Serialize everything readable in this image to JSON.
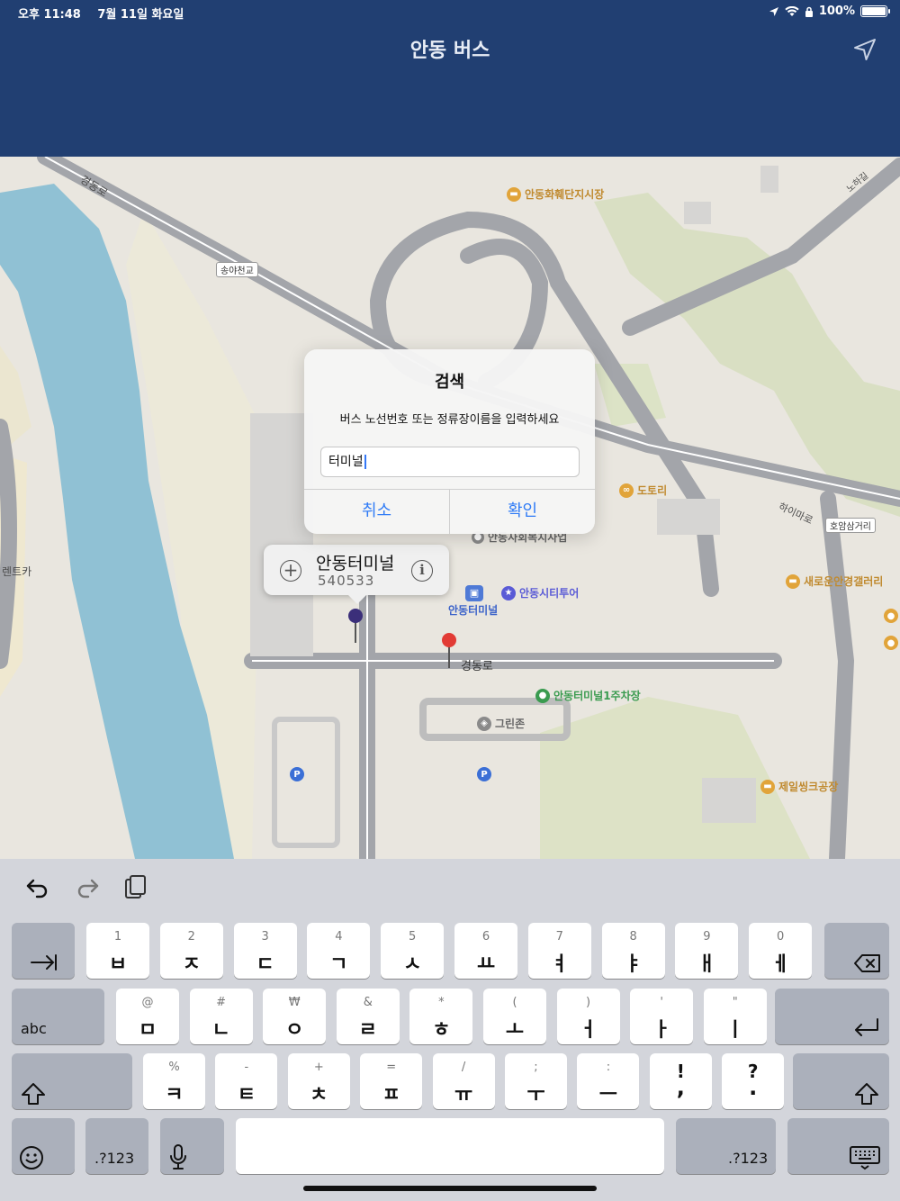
{
  "status": {
    "time": "오후 11:48",
    "date": "7월 11일 화요일",
    "battery": "100%"
  },
  "nav": {
    "title": "안동 버스"
  },
  "map": {
    "road_labels": {
      "gyeongdong_nw": "경동로",
      "songya_bridge": "송야천교",
      "nohagil": "노하길",
      "haimaro": "하이마로",
      "hoamsamgeori": "호암삼거리",
      "gyeongdong_main": "경동로",
      "rentcar": "렌트카"
    },
    "pois": {
      "hwahoe_market": "안동화훼단지시장",
      "dotori": "도토리",
      "welfare_center": "안동사회복지사업",
      "city_tour": "안동시티투어",
      "terminal_bus": "안동터미널",
      "serowoon": "새로운안경갤러리",
      "parking1": "안동터미널1주차장",
      "greenzone": "그린존",
      "jeil_sink": "제일씽크공장"
    },
    "callout": {
      "title": "안동터미널",
      "subtitle": "540533"
    }
  },
  "dialog": {
    "title": "검색",
    "message": "버스 노선번호 또는 정류장이름을 입력하세요",
    "input_value": "터미널",
    "cancel_label": "취소",
    "confirm_label": "확인"
  },
  "keyboard": {
    "row1": [
      {
        "hint": "1",
        "main": "ㅂ"
      },
      {
        "hint": "2",
        "main": "ㅈ"
      },
      {
        "hint": "3",
        "main": "ㄷ"
      },
      {
        "hint": "4",
        "main": "ㄱ"
      },
      {
        "hint": "5",
        "main": "ㅅ"
      },
      {
        "hint": "6",
        "main": "ㅛ"
      },
      {
        "hint": "7",
        "main": "ㅕ"
      },
      {
        "hint": "8",
        "main": "ㅑ"
      },
      {
        "hint": "9",
        "main": "ㅐ"
      },
      {
        "hint": "0",
        "main": "ㅔ"
      }
    ],
    "row2": [
      {
        "hint": "@",
        "main": "ㅁ"
      },
      {
        "hint": "#",
        "main": "ㄴ"
      },
      {
        "hint": "₩",
        "main": "ㅇ"
      },
      {
        "hint": "&",
        "main": "ㄹ"
      },
      {
        "hint": "*",
        "main": "ㅎ"
      },
      {
        "hint": "(",
        "main": "ㅗ"
      },
      {
        "hint": ")",
        "main": "ㅓ"
      },
      {
        "hint": "'",
        "main": "ㅏ"
      },
      {
        "hint": "\"",
        "main": "ㅣ"
      }
    ],
    "row3": [
      {
        "hint": "%",
        "main": "ㅋ"
      },
      {
        "hint": "-",
        "main": "ㅌ"
      },
      {
        "hint": "+",
        "main": "ㅊ"
      },
      {
        "hint": "=",
        "main": "ㅍ"
      },
      {
        "hint": "/",
        "main": "ㅠ"
      },
      {
        "hint": ";",
        "main": "ㅜ"
      },
      {
        "hint": ":",
        "main": "ㅡ"
      },
      {
        "hint": "!",
        "main": ","
      },
      {
        "hint": "?",
        "main": "."
      }
    ],
    "abc_label": "abc",
    "num_label_left": ".?123",
    "num_label_right": ".?123"
  }
}
